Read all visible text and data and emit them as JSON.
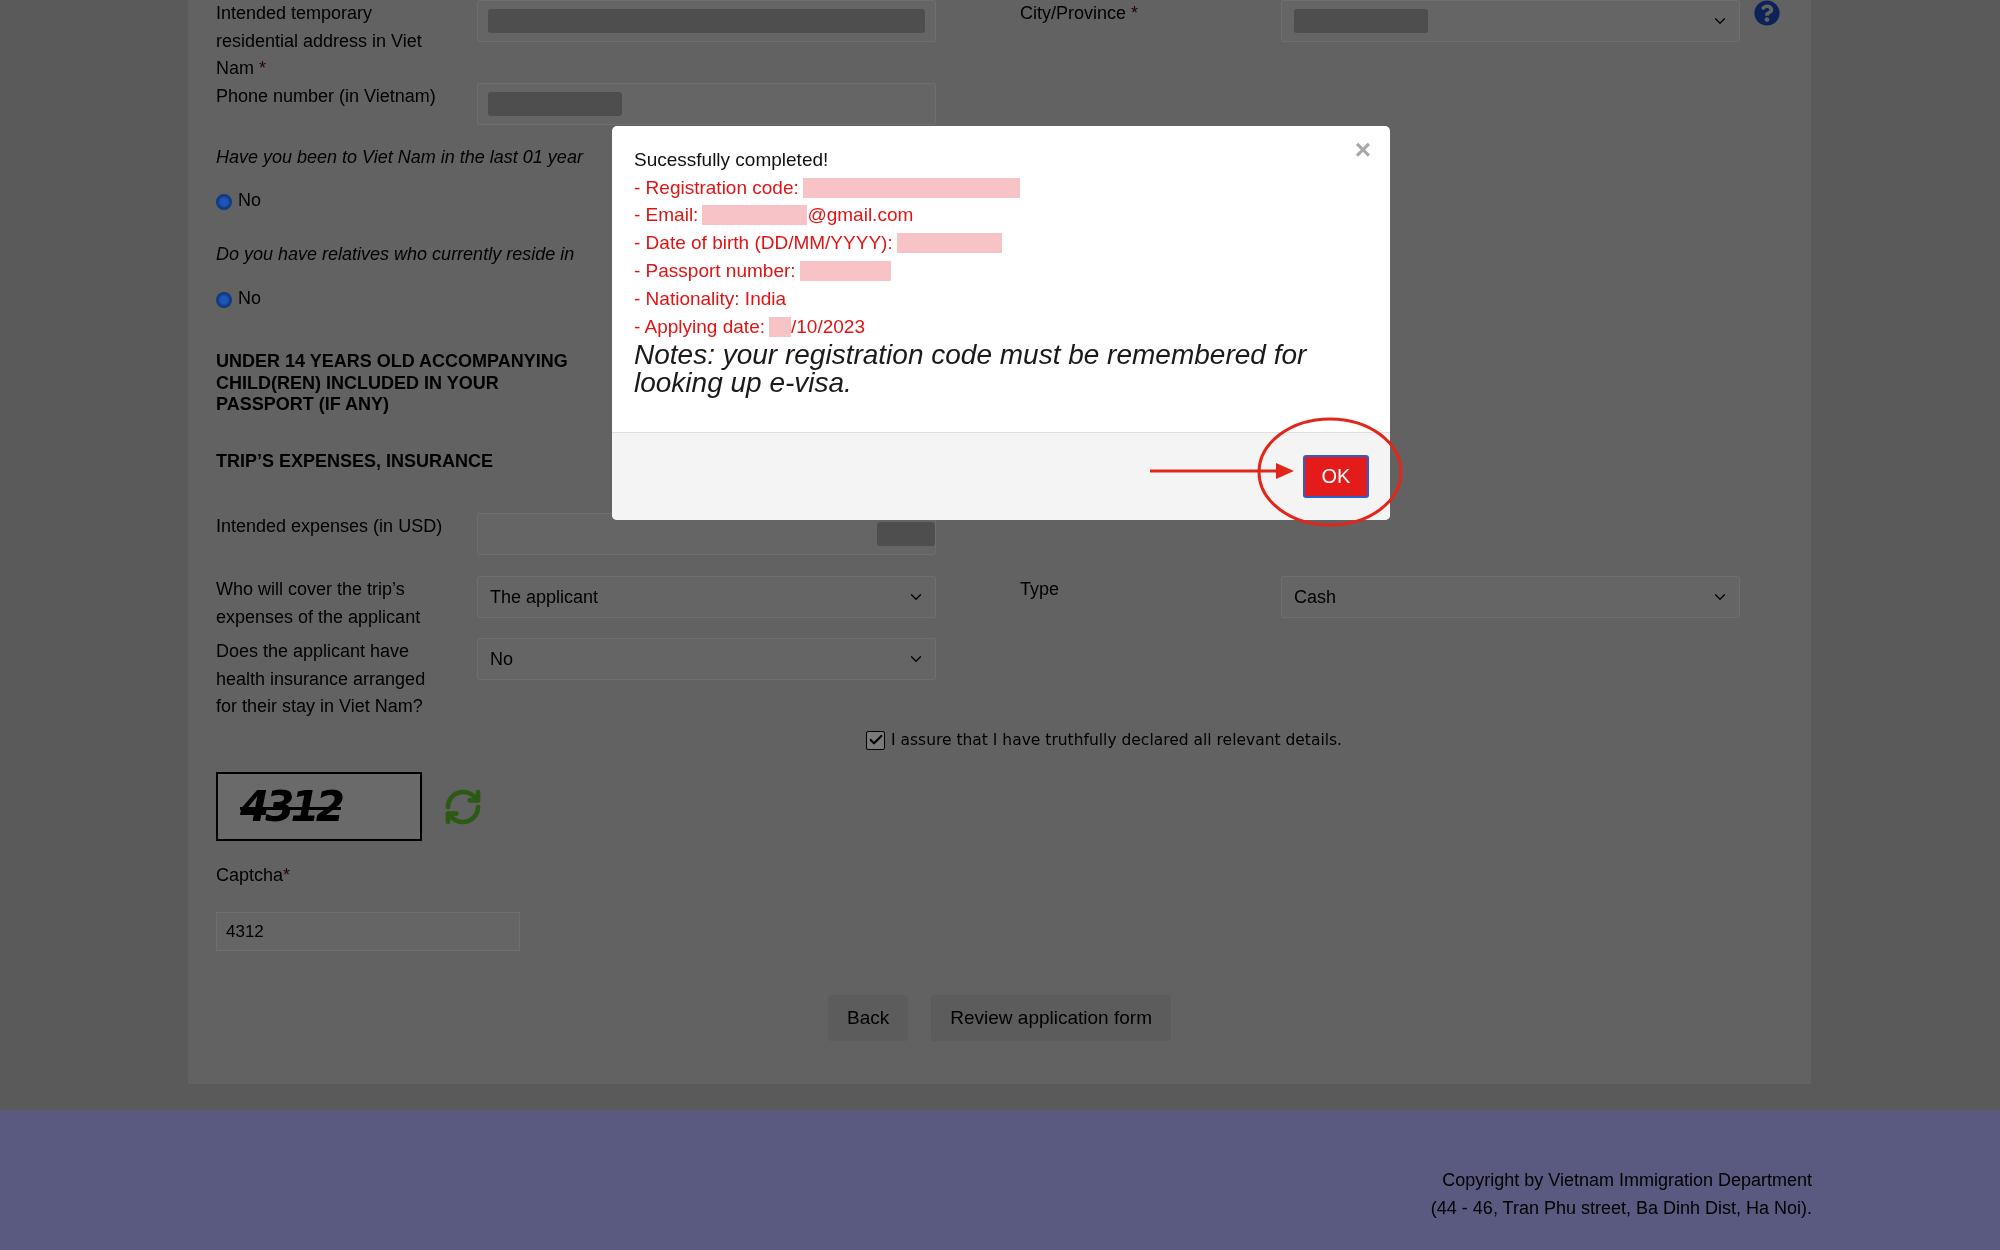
{
  "form": {
    "top_rows": [
      {
        "fields": [
          {
            "label": "Intended temporary residential address in Viet Nam",
            "required_mark": "*",
            "kind": "input",
            "redacted": true,
            "help": false
          },
          {
            "label": "City/Province",
            "required_mark": "*",
            "kind": "select",
            "redacted": true,
            "help": true
          }
        ]
      },
      {
        "fields": [
          {
            "label": "Phone number (in Vietnam)",
            "kind": "input",
            "redacted": true,
            "help": false
          }
        ]
      }
    ],
    "questions": [
      {
        "text": "Have you been to Viet Nam in the last 01 year",
        "options": [
          {
            "label": "No",
            "selected": true
          }
        ]
      },
      {
        "text": "Do you have relatives who currently reside in",
        "options": [
          {
            "label": "No",
            "selected": true
          }
        ]
      }
    ],
    "headings": [
      "UNDER 14 YEARS OLD ACCOMPANYING CHILD(REN) INCLUDED IN YOUR PASSPORT (IF ANY)",
      "TRIP’S EXPENSES, INSURANCE"
    ],
    "expense_rows": [
      {
        "fields": [
          {
            "label": "Intended expenses (in USD)",
            "kind": "input",
            "redacted": true,
            "help": false
          }
        ]
      },
      {
        "fields": [
          {
            "label": "Who will cover the trip’s expenses of the applicant",
            "kind": "select",
            "value": "The applicant",
            "redacted": false,
            "help": false
          },
          {
            "label": "Type",
            "kind": "select",
            "value": "Cash",
            "redacted": false,
            "help": false
          }
        ]
      },
      {
        "fields": [
          {
            "label": "Does the applicant have health insurance arranged for their stay in Viet Nam?",
            "kind": "select",
            "value": "No",
            "redacted": false,
            "help": false
          }
        ]
      }
    ],
    "declaration": {
      "checked": true,
      "text": "I assure that I have truthfully declared all relevant details."
    },
    "captcha": {
      "image_text": "4312",
      "label": "Captcha",
      "required_mark": "*",
      "value": "4312"
    },
    "buttons": [
      {
        "label": "Back"
      },
      {
        "label": "Review application form"
      }
    ]
  },
  "footer": {
    "lines": [
      "Copyright by Vietnam Immigration Department",
      "(44 - 46, Tran Phu street, Ba Dinh Dist, Ha Noi)."
    ]
  },
  "dialog": {
    "close": "×",
    "title": "Sucessfully completed!",
    "details": [
      {
        "label": "- Registration code:",
        "redacted": true
      },
      {
        "label": "- Email:",
        "redacted": true,
        "value": "@gmail.com"
      },
      {
        "label": "- Date of birth (DD/MM/YYYY):",
        "redacted": true
      },
      {
        "label": "- Passport number:",
        "redacted": true
      },
      {
        "label": "- Nationality: India",
        "redacted": false
      },
      {
        "label": "- Applying date:",
        "redacted": true,
        "value": "/10/2023"
      }
    ],
    "note": "Notes: your registration code must be remembered for looking up e-visa.",
    "buttons": [
      {
        "label": "OK",
        "focused": true
      }
    ]
  }
}
